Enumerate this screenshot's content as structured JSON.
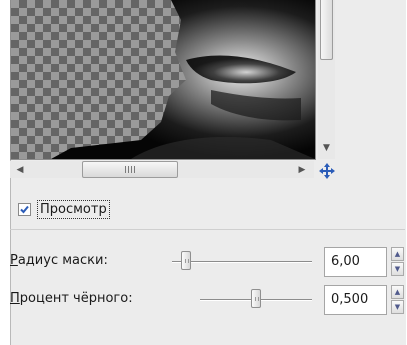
{
  "preview": {
    "checkbox_label": "Просмотр",
    "checked": true,
    "scroll_grip": "III"
  },
  "icons": {
    "scroll_left": "◀",
    "scroll_right": "▶",
    "scroll_down": "▼",
    "navigate": "move-arrows-icon",
    "spin_up": "▲",
    "spin_down": "▼"
  },
  "controls": [
    {
      "label_underlined": "Р",
      "label_rest": "адиус маски:",
      "value": "6,00",
      "slider_position": 0.1
    },
    {
      "label_underlined": "П",
      "label_rest": "роцент чёрного:",
      "value": "0,500",
      "slider_position": 0.5
    }
  ],
  "colors": {
    "accent": "#2b5cb8",
    "panel": "#ececec"
  }
}
